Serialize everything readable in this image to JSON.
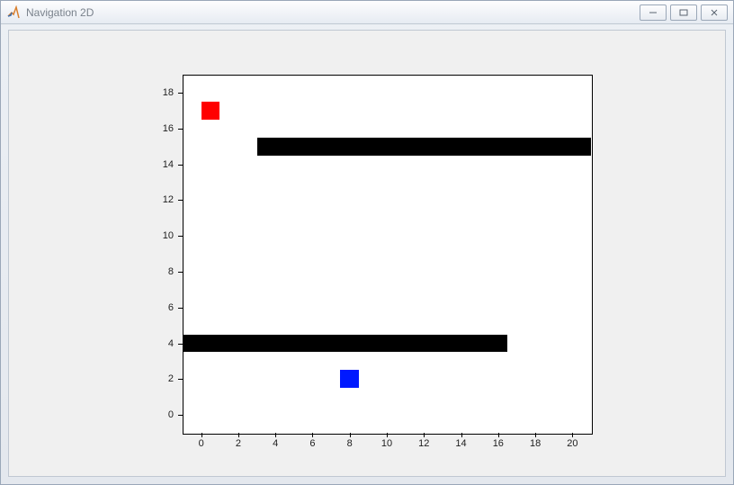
{
  "window": {
    "title": "Navigation 2D",
    "buttons": {
      "minimize": "–",
      "maximize": "❐",
      "close": "✕"
    }
  },
  "chart_data": {
    "type": "scatter",
    "xlim": [
      -1,
      21
    ],
    "ylim": [
      -1,
      19
    ],
    "xticks": [
      0,
      2,
      4,
      6,
      8,
      10,
      12,
      14,
      16,
      18,
      20
    ],
    "yticks": [
      0,
      2,
      4,
      6,
      8,
      10,
      12,
      14,
      16,
      18
    ],
    "xlabel": "",
    "ylabel": "",
    "title": "",
    "rects": [
      {
        "name": "obstacle-top",
        "x0": 3.0,
        "x1": 21.0,
        "y0": 14.5,
        "y1": 15.5,
        "color": "#000000"
      },
      {
        "name": "obstacle-bottom",
        "x0": -1.0,
        "x1": 16.5,
        "y0": 3.5,
        "y1": 4.5,
        "color": "#000000"
      },
      {
        "name": "goal-marker",
        "x0": 0.0,
        "x1": 1.0,
        "y0": 16.5,
        "y1": 17.5,
        "color": "#ff0000"
      },
      {
        "name": "agent-marker",
        "x0": 7.5,
        "x1": 8.5,
        "y0": 1.5,
        "y1": 2.5,
        "color": "#0019ff"
      }
    ]
  }
}
